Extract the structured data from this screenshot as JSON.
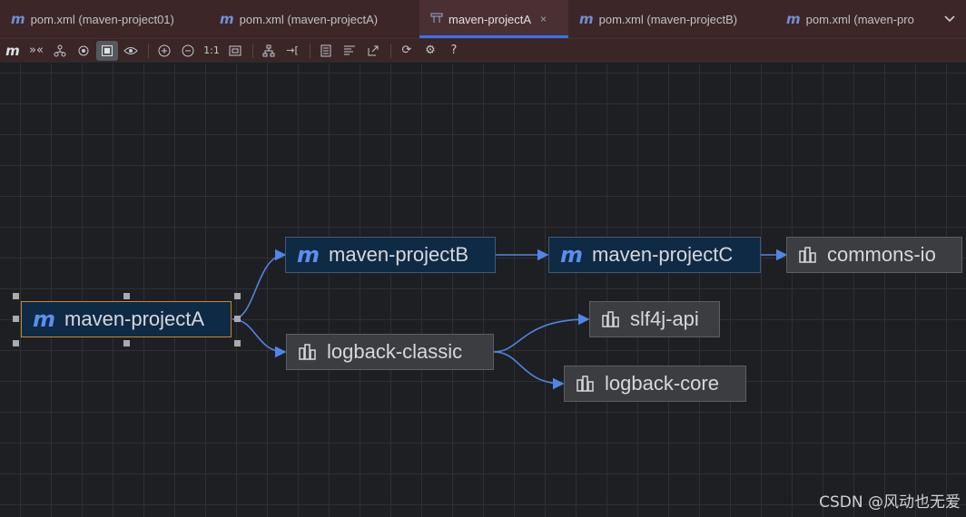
{
  "tabs": [
    {
      "icon": "m",
      "label": "pom.xml (maven-project01)"
    },
    {
      "icon": "m",
      "label": "pom.xml (maven-projectA)"
    },
    {
      "icon": "diagram",
      "label": "maven-projectA",
      "active": true,
      "close": "×"
    },
    {
      "icon": "m",
      "label": "pom.xml (maven-projectB)"
    },
    {
      "icon": "m",
      "label": "pom.xml (maven-pro"
    }
  ],
  "tab_more_icon": "chevron-down-icon",
  "toolbar": {
    "items": [
      "m",
      "»«",
      "⛙",
      "◎",
      "▣",
      "👁",
      "⊕",
      "⊖",
      "1:1",
      "⊡",
      "品",
      "→[",
      "▤",
      "≡",
      "↗",
      "⟳",
      "⚙",
      "?"
    ]
  },
  "nodes": {
    "projectA": "maven-projectA",
    "projectB": "maven-projectB",
    "projectC": "maven-projectC",
    "commons_io": "commons-io",
    "logback_classic": "logback-classic",
    "slf4j_api": "slf4j-api",
    "logback_core": "logback-core"
  },
  "colors": {
    "accent": "#3574f0",
    "edge": "#4f86e8",
    "selection": "#c68a2c"
  },
  "watermark": "CSDN @风动也无爱"
}
